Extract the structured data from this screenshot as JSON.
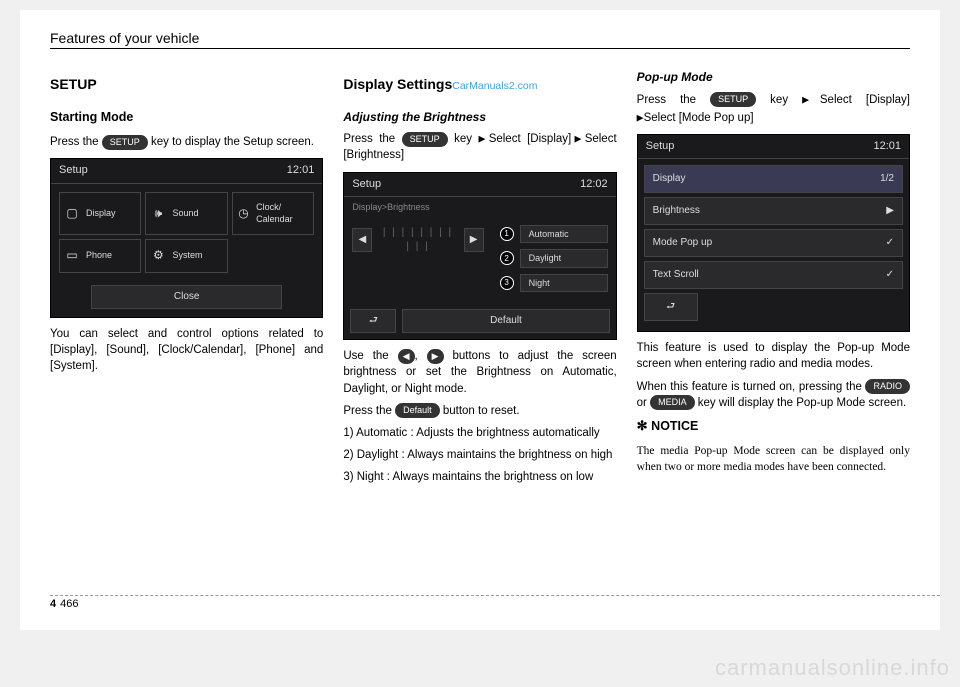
{
  "header": "Features of your vehicle",
  "page_chapter": "4",
  "page_number": "466",
  "watermark_top": "CarManuals2.com",
  "watermark_bottom": "carmanualsonline.info",
  "col1": {
    "h2": "SETUP",
    "h3": "Starting Mode",
    "p1a": "Press the ",
    "key": "SETUP",
    "p1b": " key to display the Setup screen.",
    "scr": {
      "title": "Setup",
      "time": "12:01",
      "cells": [
        "Display",
        "Sound",
        "Clock/ Calendar",
        "Phone",
        "System"
      ],
      "close": "Close"
    },
    "p2": "You can select and control options related to [Display], [Sound], [Clock/Calendar], [Phone] and [System]."
  },
  "col2": {
    "h2": "Display Settings",
    "h4": "Adjusting the Brightness",
    "p1a": "Press the ",
    "key": "SETUP",
    "p1b": " key ",
    "p1c": "Select [Display]",
    "p1d": "Select [Brightness]",
    "scr": {
      "title": "Setup",
      "time": "12:02",
      "sub": "Display>Brightness",
      "opts": [
        "Automatic",
        "Daylight",
        "Night"
      ],
      "default": "Default"
    },
    "p2a": "Use the ",
    "p2b": ", ",
    "p2c": " buttons to adjust the screen brightness or set the Brightness on Automatic, Daylight, or Night mode.",
    "p3a": "Press the ",
    "defaultKey": "Default",
    "p3b": " button to reset.",
    "li1": "1) Automatic : Adjusts the brightness automatically",
    "li2": "2) Daylight : Always maintains the brightness on high",
    "li3": "3) Night : Always maintains the brightness on low"
  },
  "col3": {
    "h4": "Pop-up Mode",
    "p1a": "Press the ",
    "key": "SETUP",
    "p1b": " key ",
    "p1c": "Select [Display]",
    "p1d": "Select [Mode Pop up]",
    "scr": {
      "title": "Setup",
      "time": "12:01",
      "header": "Display",
      "counter": "1/2",
      "rows": [
        "Brightness",
        "Mode Pop up",
        "Text Scroll"
      ]
    },
    "p2": "This feature is used to display the Pop-up Mode screen when entering radio and media modes.",
    "p3a": "When this feature is turned on, pressing the ",
    "radioKey": "RADIO",
    "p3b": " or ",
    "mediaKey": "MEDIA",
    "p3c": " key will display the Pop-up Mode screen.",
    "noticeTitle": "NOTICE",
    "noticeBody": "The media Pop-up Mode screen can be displayed only when two or more media modes have been connected."
  }
}
